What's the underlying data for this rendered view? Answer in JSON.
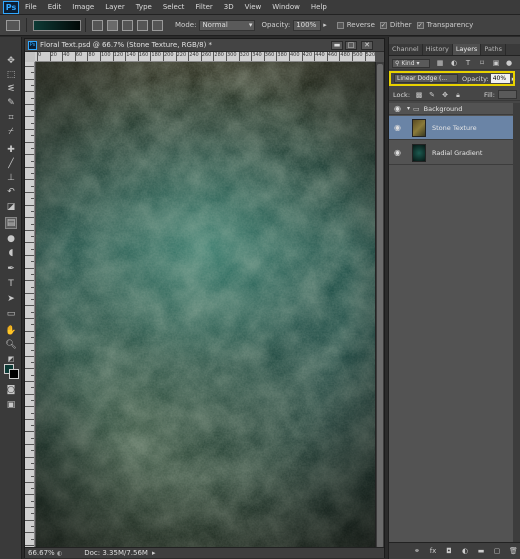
{
  "app": {
    "logo": "Ps"
  },
  "menu": [
    "File",
    "Edit",
    "Image",
    "Layer",
    "Type",
    "Select",
    "Filter",
    "3D",
    "View",
    "Window",
    "Help"
  ],
  "options": {
    "mode_label": "Mode:",
    "mode_value": "Normal",
    "opacity_label": "Opacity:",
    "opacity_value": "100%",
    "reverse_label": "Reverse",
    "dither_label": "Dither",
    "transparency_label": "Transparency",
    "gradient_colors": [
      "#0d3a35",
      "#020807"
    ]
  },
  "document": {
    "title": "Floral Text.psd @ 66.7% (Stone Texture, RGB/8) *",
    "icon_text": "Ps",
    "minimize": "▬",
    "maximize": "□",
    "close": "✕",
    "zoom": "66.67%",
    "doc_size": "Doc: 3.35M/7.56M",
    "ruler_labels": [
      "0",
      "20",
      "40",
      "60",
      "80",
      "100",
      "120",
      "140",
      "160",
      "180",
      "200",
      "220",
      "240",
      "260",
      "280",
      "300",
      "320",
      "340",
      "360",
      "380",
      "400",
      "420",
      "440",
      "460",
      "480",
      "500",
      "520",
      "540"
    ]
  },
  "panel": {
    "tabs": [
      "Channel",
      "History",
      "Layers",
      "Paths"
    ],
    "active_tab": "Layers",
    "kind_label": "Kind",
    "blend_mode": "Linear Dodge (...",
    "opacity_label": "Opacity:",
    "opacity_value": "40%",
    "lock_label": "Lock:",
    "fill_label": "Fill:",
    "layers": [
      {
        "name": "Background",
        "type": "group"
      },
      {
        "name": "Stone Texture",
        "type": "layer",
        "selected": true
      },
      {
        "name": "Radial Gradient",
        "type": "layer"
      }
    ],
    "highlight_color": "#e8d200"
  },
  "colors": {
    "foreground": "#0d3a35",
    "background": "#000000"
  }
}
